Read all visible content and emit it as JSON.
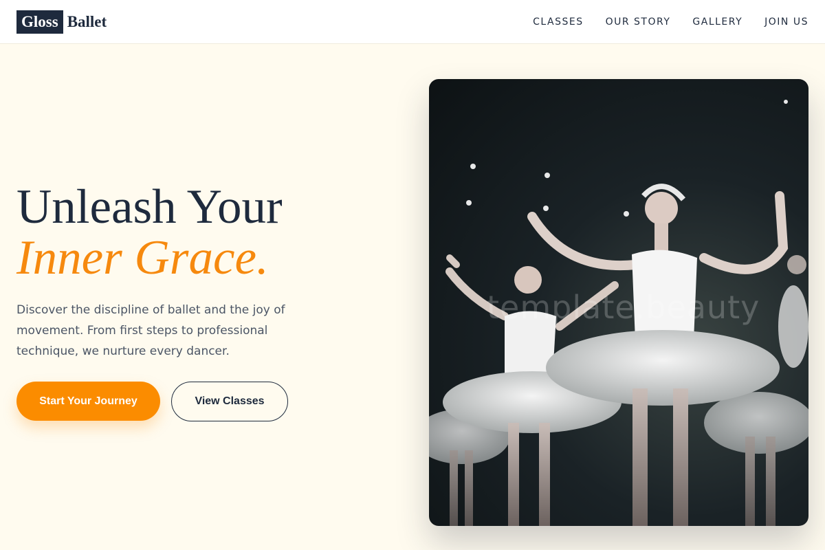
{
  "brand": {
    "box_text": "Gloss",
    "text": "Ballet"
  },
  "nav": [
    {
      "label": "CLASSES"
    },
    {
      "label": "OUR STORY"
    },
    {
      "label": "GALLERY"
    },
    {
      "label": "JOIN US"
    }
  ],
  "hero": {
    "headline_line1": "Unleash Your",
    "headline_line2": "Inner Grace.",
    "description": "Discover the discipline of ballet and the joy of movement. From first steps to professional technique, we nurture every dancer.",
    "primary_cta": "Start Your Journey",
    "secondary_cta": "View Classes",
    "watermark": "template.beauty"
  },
  "colors": {
    "background": "#fffbef",
    "navy": "#1e2a3d",
    "accent": "#fb8c00"
  }
}
